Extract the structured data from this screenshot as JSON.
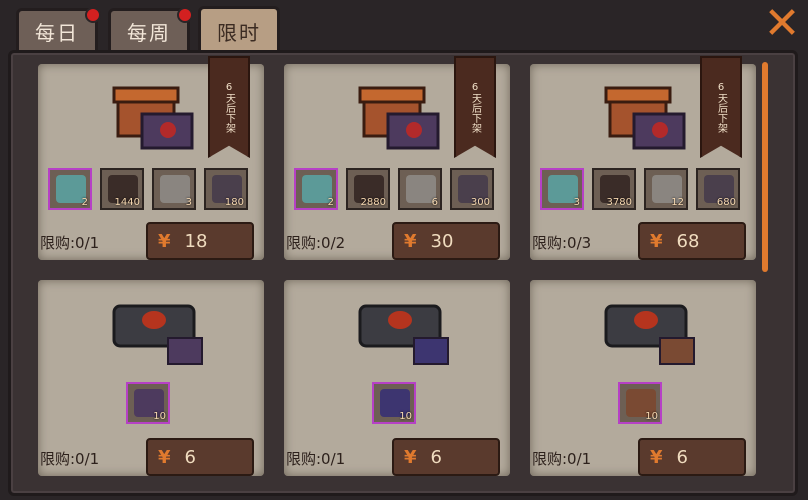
{
  "tabs": [
    {
      "label": "每日",
      "dot": true,
      "active": false
    },
    {
      "label": "每周",
      "dot": true,
      "active": false
    },
    {
      "label": "限时",
      "dot": false,
      "active": true
    }
  ],
  "close_icon": "close-x-icon",
  "cards": [
    {
      "banner": "6天后下架",
      "items": [
        "2",
        "1440",
        "3",
        "180"
      ],
      "limit": "限购:0/1",
      "price": "18"
    },
    {
      "banner": "6天后下架",
      "items": [
        "2",
        "2880",
        "6",
        "300"
      ],
      "limit": "限购:0/2",
      "price": "30"
    },
    {
      "banner": "6天后下架",
      "items": [
        "3",
        "3780",
        "12",
        "680"
      ],
      "limit": "限购:0/3",
      "price": "68"
    },
    {
      "items": [
        "10"
      ],
      "limit": "限购:0/1",
      "price": "6"
    },
    {
      "items": [
        "10"
      ],
      "limit": "限购:0/1",
      "price": "6"
    },
    {
      "items": [
        "10"
      ],
      "limit": "限购:0/1",
      "price": "6"
    }
  ],
  "currency_icon": "coin-icon",
  "colors": {
    "accent": "#e07a2e",
    "price_bg": "#5a3a2d",
    "purple_frame": "#b640c6"
  }
}
